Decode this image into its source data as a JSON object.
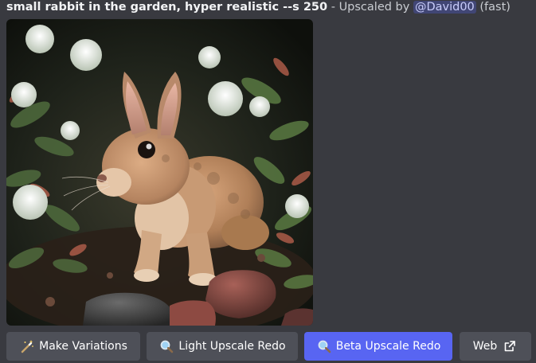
{
  "message": {
    "prompt": "small rabbit in the garden, hyper realistic --s 250",
    "separator": " - ",
    "upscaled_by": "Upscaled by ",
    "mention": "@David00",
    "mode": " (fast)"
  },
  "image": {
    "alt": "small rabbit in the garden, hyper realistic"
  },
  "buttons": {
    "make_variations": {
      "label": "Make Variations",
      "icon": "magic-wand-icon"
    },
    "light_upscale_redo": {
      "label": "Light Upscale Redo",
      "icon": "magnifier-icon"
    },
    "beta_upscale_redo": {
      "label": "Beta Upscale Redo",
      "icon": "magnifier-icon"
    },
    "web": {
      "label": "Web",
      "icon": "external-link-icon"
    }
  },
  "colors": {
    "background": "#393a40",
    "secondary_button": "#4e5058",
    "primary_button": "#5865f2",
    "mention_bg": "#414675"
  }
}
